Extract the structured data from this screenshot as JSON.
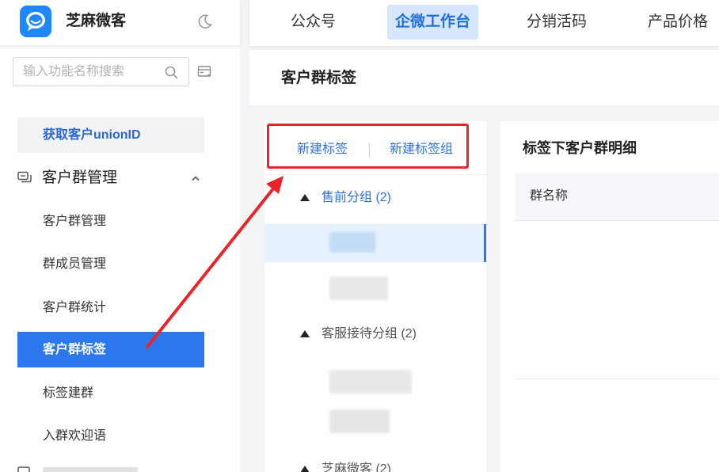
{
  "brand": {
    "name": "芝麻微客",
    "logo_color": "#1e88ff"
  },
  "search": {
    "placeholder": "输入功能名称搜索"
  },
  "sidebar": {
    "top_item": "获取客户unionID",
    "group_title": "客户群管理",
    "items": [
      {
        "label": "客户群管理"
      },
      {
        "label": "群成员管理"
      },
      {
        "label": "客户群统计"
      },
      {
        "label": "客户群标签"
      },
      {
        "label": "标签建群"
      },
      {
        "label": "入群欢迎语"
      }
    ]
  },
  "tabs": [
    {
      "label": "公众号"
    },
    {
      "label": "企微工作台"
    },
    {
      "label": "分销活码"
    },
    {
      "label": "产品价格"
    }
  ],
  "page": {
    "title": "客户群标签"
  },
  "tag_panel": {
    "new_tag": "新建标签",
    "new_group": "新建标签组",
    "groups": [
      {
        "label": "售前分组 (2)"
      },
      {
        "label": "客服接待分组 (2)"
      },
      {
        "label": "芝麻微客 (2)"
      }
    ]
  },
  "detail": {
    "title": "标签下客户群明细",
    "column": "群名称"
  },
  "colors": {
    "accent": "#2b77ee",
    "link": "#2f6fd6",
    "annotation": "#e8252a"
  }
}
